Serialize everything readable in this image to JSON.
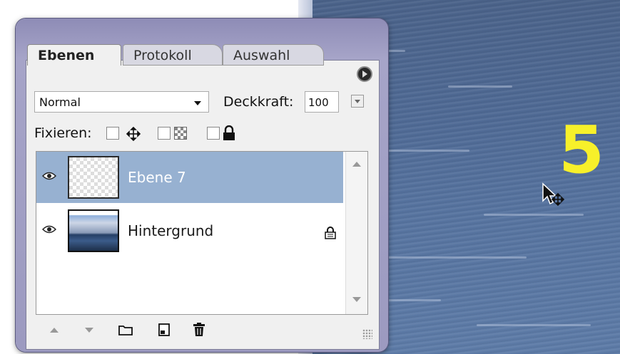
{
  "panel": {
    "tabs": [
      {
        "label": "Ebenen",
        "active": true
      },
      {
        "label": "Protokoll",
        "active": false
      },
      {
        "label": "Auswahl",
        "active": false
      }
    ],
    "menu_icon": "panel-menu-icon"
  },
  "blend_mode": {
    "value": "Normal"
  },
  "opacity": {
    "label": "Deckkraft:",
    "value": "100"
  },
  "lock": {
    "label": "Fixieren:",
    "icons": [
      "lock-position-icon",
      "lock-transparency-icon",
      "lock-all-icon"
    ]
  },
  "layers": [
    {
      "name": "Ebene 7",
      "selected": true,
      "visible": true,
      "locked": false
    },
    {
      "name": "Hintergrund",
      "selected": false,
      "visible": true,
      "locked": true
    }
  ],
  "bottom_bar": {
    "icons": [
      "move-up-icon",
      "move-down-icon",
      "new-group-icon",
      "new-layer-icon",
      "trash-icon"
    ]
  },
  "canvas": {
    "overlay_text": "5",
    "overlay_color": "#f7f02a"
  },
  "colors": {
    "selected_row": "#97b1d1",
    "panel_frame": "#9c9ac0",
    "water": "#4f6a95"
  }
}
